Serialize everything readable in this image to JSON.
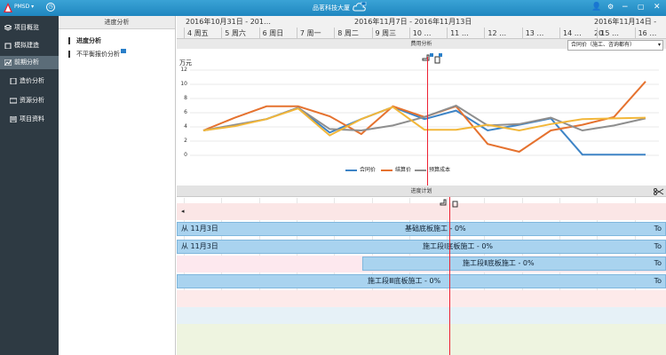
{
  "top": {
    "app": "PMSD",
    "project": "品茗科技大厦"
  },
  "nav": {
    "items": [
      {
        "label": "项目概览"
      },
      {
        "label": "模拟建造"
      },
      {
        "label": "前期分析"
      },
      {
        "label": "造价分析"
      },
      {
        "label": "资源分析"
      },
      {
        "label": "项目资料"
      }
    ]
  },
  "panel2": {
    "title": "进度分析",
    "items": [
      "进度分析",
      "不平衡报价分析"
    ]
  },
  "timeline": {
    "weeks": [
      "2016年10月31日 - 201…",
      "2016年11月7日 - 2016年11月13日",
      "2016年11月14日 - 20"
    ],
    "days": [
      "4 周五",
      "5 周六",
      "6 周日",
      "7 周一",
      "8 周二",
      "9 周三",
      "10 …",
      "11 …",
      "12 …",
      "13 …",
      "14 …",
      "15 …",
      "16 …"
    ]
  },
  "cost_chart": {
    "header": "费用分析",
    "dropdown": "合同价（施工、咨询都有）",
    "unit": "万元",
    "chart_data": {
      "type": "line",
      "ylim": [
        0,
        12
      ],
      "yticks": [
        0,
        2,
        4,
        6,
        8,
        10,
        12
      ],
      "grid": true,
      "legend_position": "bottom",
      "series": [
        {
          "name": "合同价",
          "color": "#3e84c6",
          "values": [
            3.5,
            4.2,
            5.1,
            6.7,
            3.2,
            5.1,
            6.8,
            5.1,
            6.3,
            3.5,
            4.3,
            5.2,
            0.1,
            0.1,
            0.1
          ]
        },
        {
          "name": "结算价",
          "color": "#e5722f",
          "values": [
            3.5,
            5.3,
            6.9,
            6.9,
            5.5,
            3.0,
            6.9,
            5.4,
            6.9,
            1.6,
            0.5,
            3.5,
            4.3,
            5.4,
            10.4
          ]
        },
        {
          "name": "预算成本",
          "color": "#8e8e8e",
          "values": [
            3.5,
            4.3,
            5.1,
            6.7,
            3.7,
            3.5,
            4.2,
            5.4,
            7.0,
            4.2,
            4.4,
            5.3,
            3.5,
            4.2,
            5.2
          ]
        },
        {
          "name": "",
          "color": "#f2b73a",
          "values": [
            3.5,
            4.1,
            5.1,
            6.6,
            2.8,
            5.1,
            6.8,
            3.6,
            3.6,
            4.3,
            3.5,
            4.4,
            5.1,
            5.2,
            5.3
          ]
        }
      ]
    }
  },
  "gantt": {
    "header": "进度计划",
    "rows": [
      {
        "from": "从 11月3日",
        "label": "基础底板施工 - 0%",
        "to": "To"
      },
      {
        "from": "从 11月3日",
        "label": "施工段Ⅰ底板施工 - 0%",
        "to": "To"
      },
      {
        "from": "",
        "label": "施工段Ⅱ底板施工 - 0%",
        "to": "To"
      },
      {
        "from": "",
        "label": "施工段Ⅲ底板施工 - 0%",
        "to": "To"
      }
    ]
  }
}
